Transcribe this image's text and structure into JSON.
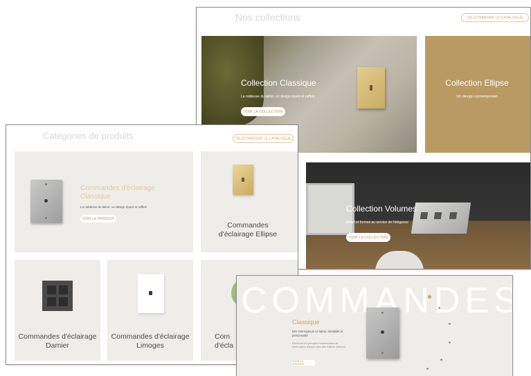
{
  "collections": {
    "title": "Nos collections",
    "download_label": "TÉLÉCHARGER LE CATALOGUE",
    "classique": {
      "title": "Collection Classique",
      "subtitle": "La noblesse du laiton, un design épuré et raffiné",
      "cta": "VOIR LA COLLECTION"
    },
    "ellipse": {
      "title": "Collection Ellipse",
      "subtitle": "Un design contemporain"
    },
    "volumes": {
      "title": "Collection Volumes",
      "subtitle": "Relief et formes au service de l'élégance",
      "cta": "VOIR LA COLLECTION"
    }
  },
  "categories": {
    "title": "Catégories de produits",
    "download_label": "TÉLÉCHARGER LE CATALOGUE",
    "classique": {
      "title": "Commandes d'éclairage Classique",
      "desc": "La noblesse du laiton, un design épuré et raffiné",
      "cta": "VOIR LE PRODUIT"
    },
    "ellipse": {
      "label": "Commandes d'éclairage Ellipse"
    },
    "damier": {
      "label": "Commandes d'éclairage Damier"
    },
    "limoges": {
      "label": "Commandes d'éclairage Limoges"
    },
    "fourth": {
      "label": "Com d'écla"
    }
  },
  "commandes": {
    "bg_word": "COMMANDES",
    "title": "Classique",
    "desc": "Des interrupteurs en laiton, durabilité et personnalité",
    "body": "Retrouvez les principes fondamentaux de l'interrupteur d'antan, avec des finitions raffinées.",
    "cta": "VOIR LE PRODUIT"
  },
  "colors": {
    "gold": "#c9a86a",
    "beige_card": "#efede9",
    "ellipse_bg": "#b99a63"
  }
}
